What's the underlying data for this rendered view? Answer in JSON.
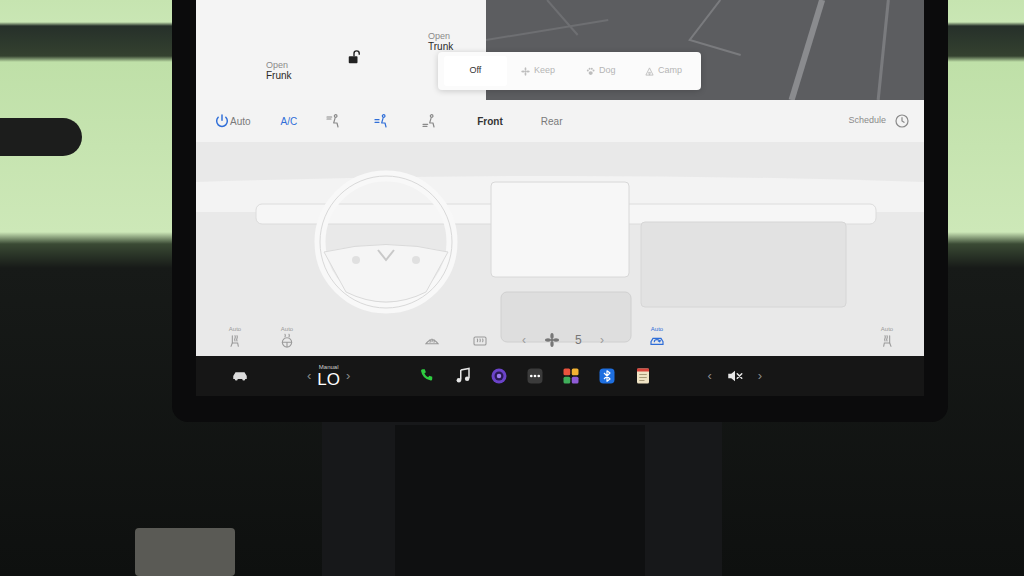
{
  "vehicle_controls": {
    "frunk": {
      "action": "Open",
      "target": "Frunk"
    },
    "trunk": {
      "action": "Open",
      "target": "Trunk"
    },
    "locked": false
  },
  "climate_keeper": [
    {
      "label": "Off",
      "selected": true
    },
    {
      "label": "Keep",
      "selected": false
    },
    {
      "label": "Dog",
      "selected": false
    },
    {
      "label": "Camp",
      "selected": false
    }
  ],
  "climate_bar": {
    "power_on": true,
    "auto": {
      "label": "Auto",
      "on": false
    },
    "ac": {
      "label": "A/C",
      "on": true
    },
    "airflow": [
      {
        "selected": false
      },
      {
        "selected": true
      },
      {
        "selected": false
      }
    ],
    "zones": [
      {
        "label": "Front",
        "selected": true
      },
      {
        "label": "Rear",
        "selected": false
      }
    ],
    "schedule": "Schedule"
  },
  "cabin_controls": {
    "left_seat": {
      "label": "Auto"
    },
    "steering_heat": {
      "label": "Auto"
    },
    "fan": {
      "prev": "‹",
      "value": "5",
      "next": "›"
    },
    "recirculation": {
      "label": "Auto",
      "on": true
    },
    "right_seat": {
      "label": "Auto"
    }
  },
  "taskbar": {
    "temperature": {
      "mode": "Manual",
      "value": "LO",
      "prev": "‹",
      "next": "›"
    },
    "volume": {
      "prev": "‹",
      "next": "›",
      "muted": true
    }
  }
}
